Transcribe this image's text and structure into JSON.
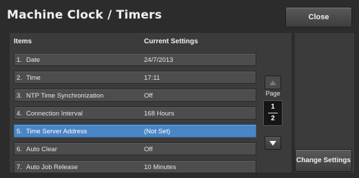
{
  "header": {
    "title": "Machine Clock / Timers",
    "close_label": "Close"
  },
  "table": {
    "col_items": "Items",
    "col_settings": "Current Settings",
    "rows": [
      {
        "num": "1.",
        "name": "Date",
        "value": "24/7/2013",
        "selected": false
      },
      {
        "num": "2.",
        "name": "Time",
        "value": "17:11",
        "selected": false
      },
      {
        "num": "3.",
        "name": "NTP Time Synchronization",
        "value": "Off",
        "selected": false
      },
      {
        "num": "4.",
        "name": "Connection Interval",
        "value": "168 Hours",
        "selected": false
      },
      {
        "num": "5.",
        "name": "Time Server Address",
        "value": "(Not Set)",
        "selected": true
      },
      {
        "num": "6.",
        "name": "Auto Clear",
        "value": "Off",
        "selected": false
      },
      {
        "num": "7.",
        "name": "Auto Job Release",
        "value": "10 Minutes",
        "selected": false
      }
    ]
  },
  "pager": {
    "label": "Page",
    "current": "1",
    "total": "2",
    "up_icon": "triangle-up-icon",
    "down_icon": "triangle-down-icon"
  },
  "actions": {
    "change_label": "Change Settings"
  },
  "colors": {
    "background": "#2c2c2c",
    "panel": "#3b3b3b",
    "row": "#4d4d4d",
    "selected_row": "#4a86c6"
  }
}
